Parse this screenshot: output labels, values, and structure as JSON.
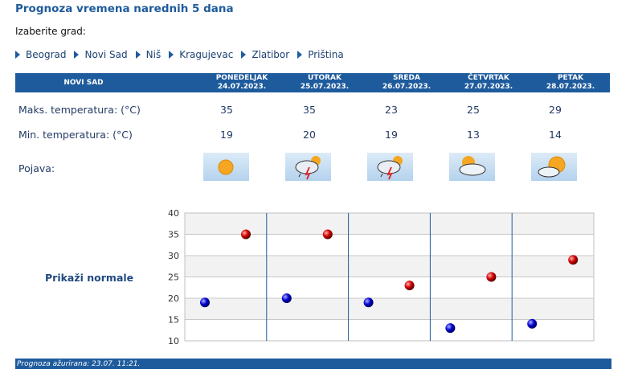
{
  "title": "Prognoza vremena narednih 5 dana",
  "city_prompt": "Izaberite grad:",
  "cities": [
    "Beograd",
    "Novi Sad",
    "Niš",
    "Kragujevac",
    "Zlatibor",
    "Priština"
  ],
  "table": {
    "city": "NOVI SAD",
    "days": [
      {
        "name": "PONEDELJAK",
        "date": "24.07.2023.",
        "max": "35",
        "min": "19",
        "icon": "sunny-icon"
      },
      {
        "name": "UTORAK",
        "date": "25.07.2023.",
        "max": "35",
        "min": "20",
        "icon": "thunderstorm-icon"
      },
      {
        "name": "SREDA",
        "date": "26.07.2023.",
        "max": "23",
        "min": "19",
        "icon": "thunderstorm-icon"
      },
      {
        "name": "ČETVRTAK",
        "date": "27.07.2023.",
        "max": "25",
        "min": "13",
        "icon": "partly-cloudy-icon"
      },
      {
        "name": "PETAK",
        "date": "28.07.2023.",
        "max": "29",
        "min": "14",
        "icon": "partly-cloudy-icon"
      }
    ],
    "max_label": "Maks. temperatura: (°C)",
    "min_label": "Min. temperatura: (°C)",
    "phenomenon_label": "Pojava:"
  },
  "show_normals": "Prikaži normale",
  "footer": "Prognoza ažurirana:  23.07. 11:21.",
  "colors": {
    "header": "#1e5b9d",
    "max_marker": "#cc0000",
    "min_marker": "#0000cc"
  },
  "chart_data": {
    "type": "scatter",
    "y_ticks": [
      10,
      15,
      20,
      25,
      30,
      35,
      40
    ],
    "ylim": [
      10,
      40
    ],
    "grid": true,
    "series": [
      {
        "values": [
          19,
          20,
          19,
          13,
          14
        ],
        "color": "#0000cc"
      },
      {
        "values": [
          35,
          35,
          23,
          25,
          29
        ],
        "color": "#cc0000"
      }
    ]
  }
}
